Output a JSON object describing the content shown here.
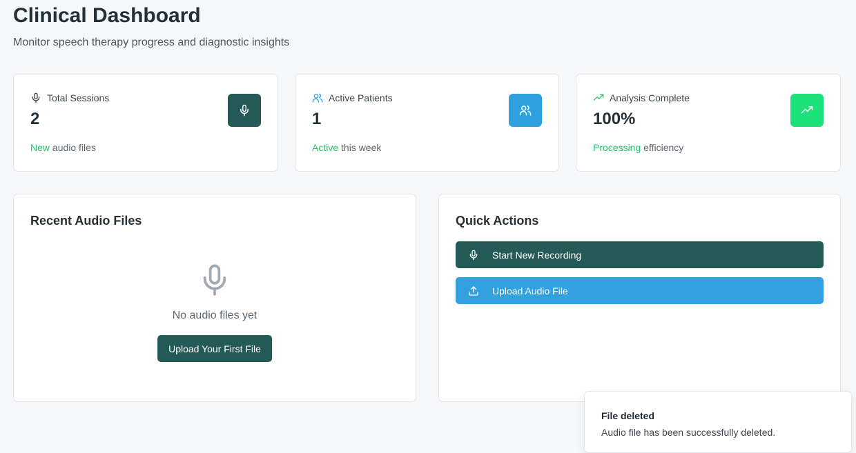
{
  "header": {
    "title": "Clinical Dashboard",
    "subtitle": "Monitor speech therapy progress and diagnostic insights"
  },
  "stats": [
    {
      "label": "Total Sessions",
      "value": "2",
      "foot_accent": "New",
      "foot_rest": " audio files",
      "icon": "mic-icon",
      "badge_color": "#245a55",
      "label_icon_color": "#3a444d"
    },
    {
      "label": "Active Patients",
      "value": "1",
      "foot_accent": "Active",
      "foot_rest": " this week",
      "icon": "users-icon",
      "badge_color": "#2f9fe0",
      "label_icon_color": "#2f9fe0"
    },
    {
      "label": "Analysis Complete",
      "value": "100%",
      "foot_accent": "Processing",
      "foot_rest": " efficiency",
      "icon": "trending-up-icon",
      "badge_color": "#1de27a",
      "label_icon_color": "#22c56b"
    }
  ],
  "recent": {
    "title": "Recent Audio Files",
    "empty_text": "No audio files yet",
    "button_label": "Upload Your First File"
  },
  "quick_actions": {
    "title": "Quick Actions",
    "actions": [
      {
        "label": "Start New Recording",
        "icon": "mic-icon",
        "color": "#245a55"
      },
      {
        "label": "Upload Audio File",
        "icon": "upload-icon",
        "color": "#33a0e0"
      }
    ]
  },
  "toast": {
    "title": "File deleted",
    "description": "Audio file has been successfully deleted."
  },
  "colors": {
    "accent_green": "#22c56b",
    "primary": "#245a55",
    "blue": "#2f9fe0"
  }
}
